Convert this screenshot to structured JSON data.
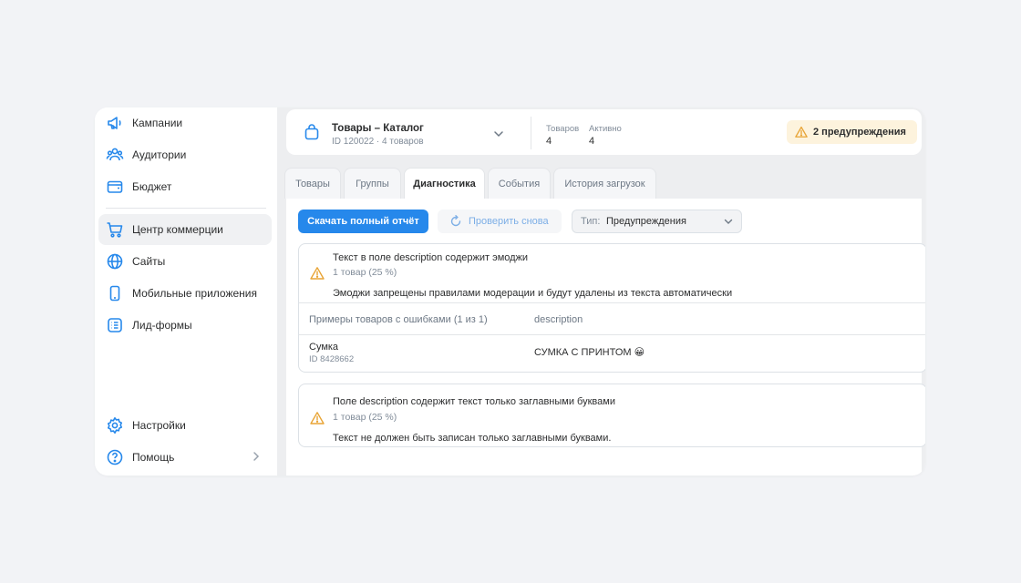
{
  "sidebar": {
    "items": [
      {
        "label": "Кампании",
        "icon": "megaphone-icon"
      },
      {
        "label": "Аудитории",
        "icon": "users-icon"
      },
      {
        "label": "Бюджет",
        "icon": "wallet-icon"
      },
      {
        "label": "Центр коммерции",
        "icon": "cart-icon",
        "active": true
      },
      {
        "label": "Сайты",
        "icon": "globe-icon"
      },
      {
        "label": "Мобильные приложения",
        "icon": "phone-icon"
      },
      {
        "label": "Лид-формы",
        "icon": "form-icon"
      }
    ],
    "bottom": [
      {
        "label": "Настройки",
        "icon": "gear-icon"
      },
      {
        "label": "Помощь",
        "icon": "help-icon"
      }
    ]
  },
  "catalog": {
    "title": "Товары – Каталог",
    "subtitle": "ID 120022 · 4 товаров",
    "stats": [
      {
        "label": "Товаров",
        "value": "4"
      },
      {
        "label": "Активно",
        "value": "4"
      }
    ],
    "warnings_label": "2 предупреждения"
  },
  "tabs": [
    {
      "label": "Товары"
    },
    {
      "label": "Группы"
    },
    {
      "label": "Диагностика",
      "active": true
    },
    {
      "label": "События"
    },
    {
      "label": "История загрузок"
    }
  ],
  "toolbar": {
    "download_label": "Скачать полный отчёт",
    "recheck_label": "Проверить снова",
    "type_prefix": "Тип:",
    "type_value": "Предупреждения"
  },
  "issues": [
    {
      "title": "Текст в поле description содержит эмоджи",
      "count": "1 товар (25 %)",
      "description": "Эмоджи запрещены правилами модерации и будут удалены из текста автоматически",
      "examples_header": "Примеры товаров с ошибками (1 из 1)",
      "field_header": "description",
      "examples": [
        {
          "name": "Сумка",
          "id": "ID 8428662",
          "value": "СУМКА С ПРИНТОМ 😀"
        }
      ]
    },
    {
      "title": "Поле description содержит текст только заглавными буквами",
      "count": "1 товар (25 %)",
      "description": "Текст не должен быть записан только заглавными буквами."
    }
  ],
  "colors": {
    "accent": "#2688eb",
    "warning": "#e8a435",
    "warning_bg": "#fdf3dd",
    "icon": "#2688eb"
  }
}
